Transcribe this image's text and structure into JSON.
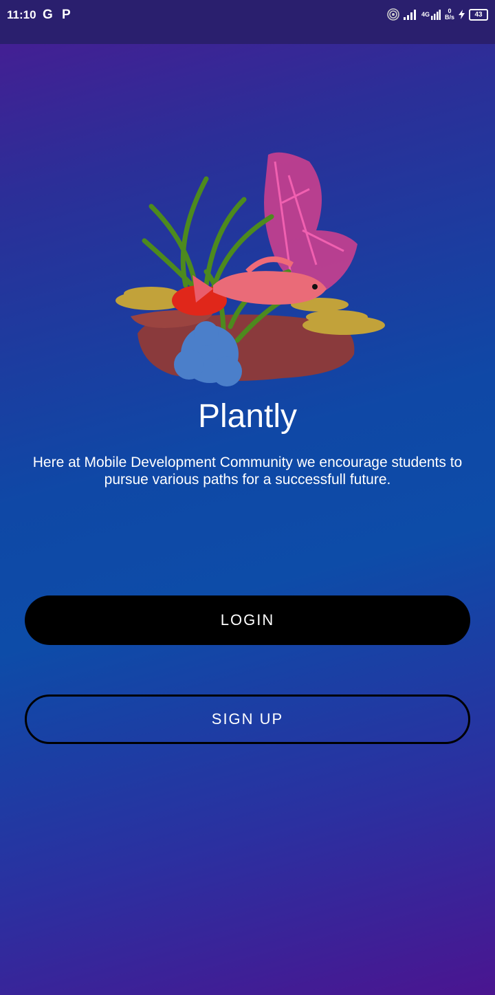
{
  "status_bar": {
    "time": "11:10",
    "apps": "G P",
    "network": "4G",
    "speed_value": "0",
    "speed_unit": "B/s",
    "battery": "43"
  },
  "hero": {
    "image": "coral-reef-fish-illustration"
  },
  "app": {
    "title": "Plantly",
    "tagline": "Here at Mobile Development Community we encourage students to pursue various paths for a successfull future."
  },
  "buttons": {
    "login": "LOGIN",
    "signup": "SIGN UP"
  },
  "colors": {
    "gradient_purple": "#4a1b92",
    "gradient_blue": "#0d4ca8",
    "button_black": "#000000"
  }
}
